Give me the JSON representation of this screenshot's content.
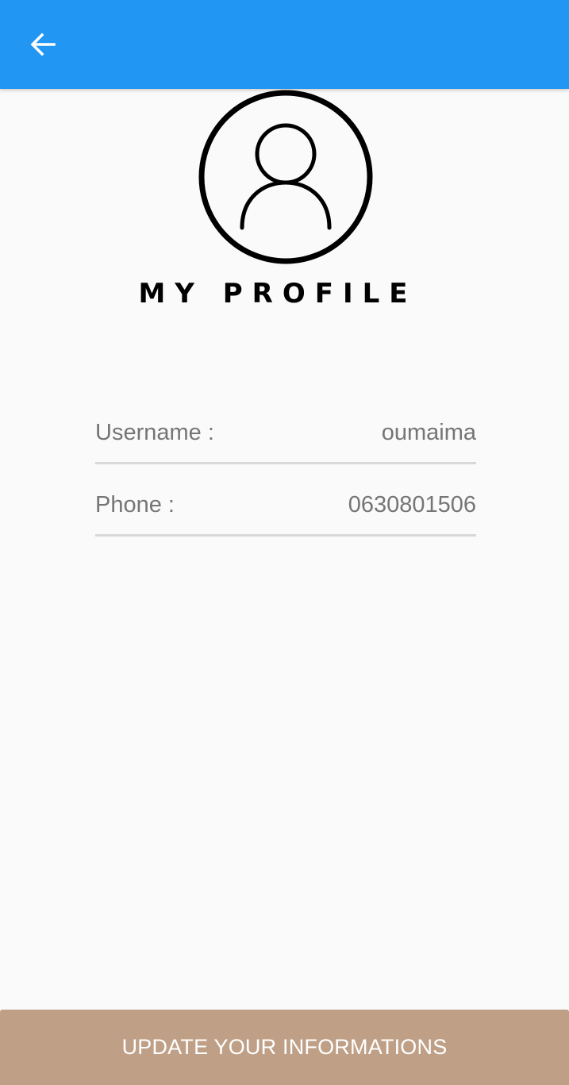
{
  "colors": {
    "app_bar": "#2196f3",
    "background": "#fafafa",
    "button": "#bfa087",
    "label_text": "#757575",
    "divider": "#d8d8d8"
  },
  "app_bar": {
    "back_icon": "arrow-back-icon"
  },
  "profile": {
    "avatar_icon": "user-profile-icon",
    "title": "MY PROFILE"
  },
  "fields": {
    "username": {
      "label": "Username :",
      "value": "oumaima"
    },
    "phone": {
      "label": "Phone :",
      "value": "0630801506"
    }
  },
  "actions": {
    "update_label": "UPDATE YOUR INFORMATIONS"
  }
}
